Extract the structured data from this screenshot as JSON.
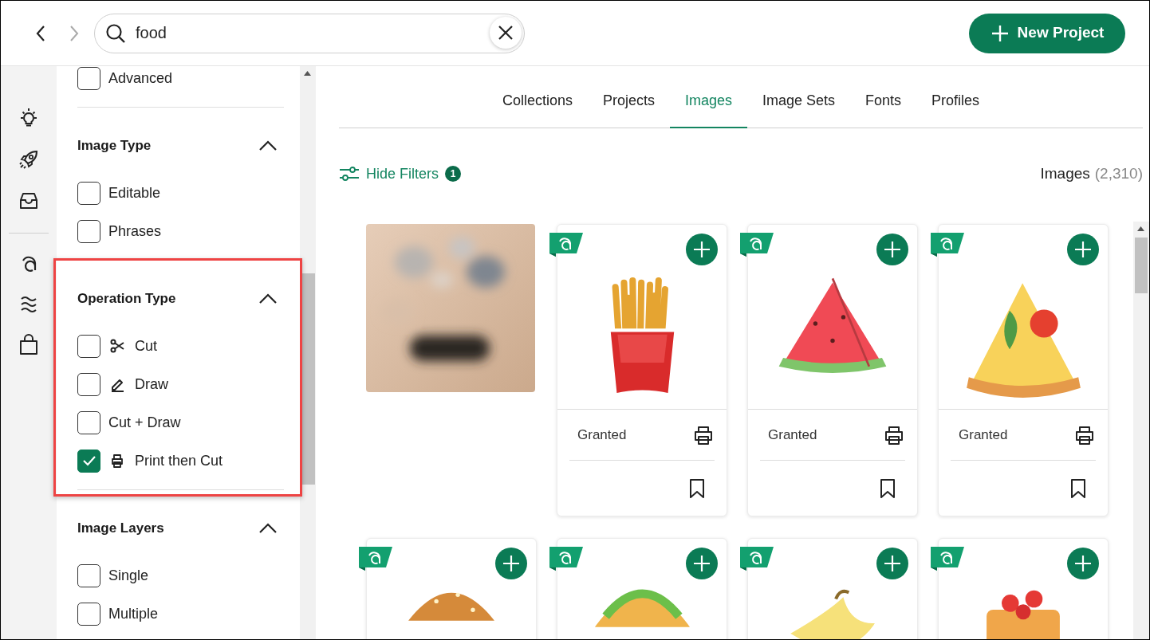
{
  "search": {
    "value": "food"
  },
  "new_project": {
    "label": "New Project"
  },
  "filters": [
    {
      "options": [
        {
          "label": "Advanced",
          "checked": false,
          "kind": "plain"
        }
      ]
    },
    {
      "title": "Image Type",
      "expanded": true,
      "highlighted": false,
      "options": [
        {
          "label": "Editable",
          "checked": false,
          "kind": "plain"
        },
        {
          "label": "Phrases",
          "checked": false,
          "kind": "plain"
        }
      ]
    },
    {
      "title": "Operation Type",
      "expanded": true,
      "highlighted": true,
      "options": [
        {
          "label": "Cut",
          "checked": false,
          "kind": "cut"
        },
        {
          "label": "Draw",
          "checked": false,
          "kind": "draw"
        },
        {
          "label": "Cut + Draw",
          "checked": false,
          "kind": "plain"
        },
        {
          "label": "Print then Cut",
          "checked": true,
          "kind": "print"
        }
      ]
    },
    {
      "title": "Image Layers",
      "expanded": true,
      "highlighted": false,
      "options": [
        {
          "label": "Single",
          "checked": false,
          "kind": "plain"
        },
        {
          "label": "Multiple",
          "checked": false,
          "kind": "plain"
        }
      ]
    }
  ],
  "tabs": [
    {
      "label": "Collections",
      "selected": false
    },
    {
      "label": "Projects",
      "selected": false
    },
    {
      "label": "Images",
      "selected": true
    },
    {
      "label": "Image Sets",
      "selected": false
    },
    {
      "label": "Fonts",
      "selected": false
    },
    {
      "label": "Profiles",
      "selected": false
    }
  ],
  "hide_filters": {
    "label": "Hide Filters",
    "count": "1"
  },
  "results": {
    "label": "Images",
    "count": "(2,310)"
  },
  "cards": [
    {
      "kind": "picture"
    },
    {
      "kind": "fries",
      "status": "Granted"
    },
    {
      "kind": "watermelon",
      "status": "Granted"
    },
    {
      "kind": "pizza",
      "status": "Granted"
    },
    {
      "kind": "burger"
    },
    {
      "kind": "taco"
    },
    {
      "kind": "banana"
    },
    {
      "kind": "cake"
    }
  ]
}
